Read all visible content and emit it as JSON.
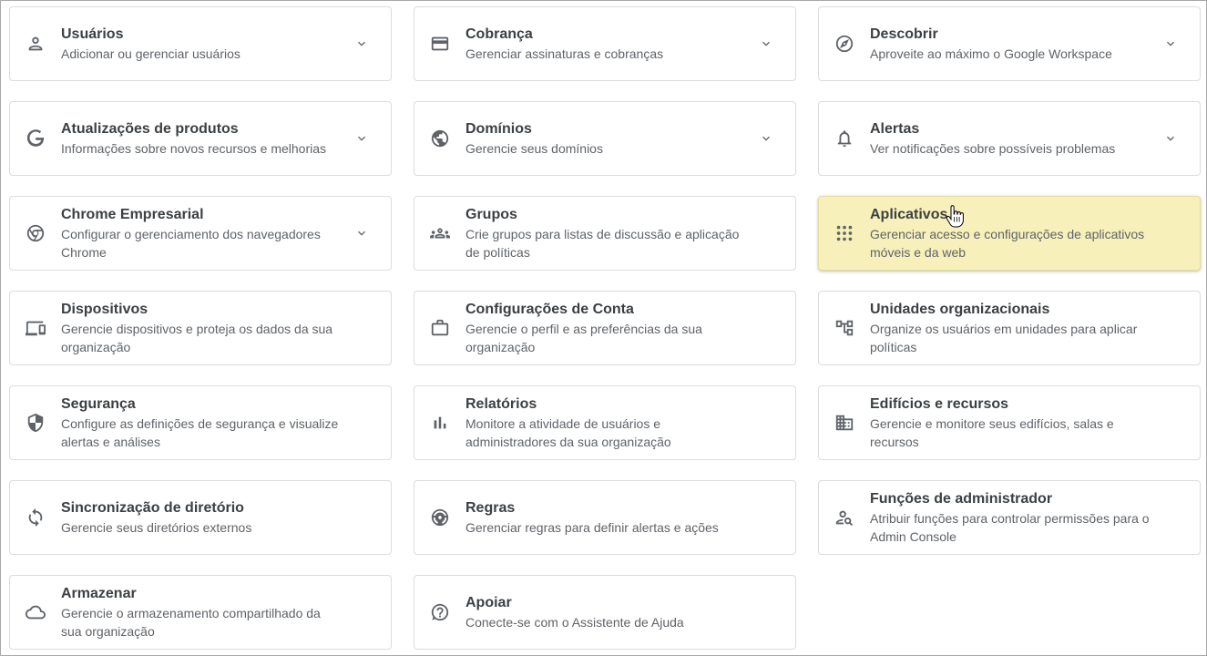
{
  "cards": [
    {
      "id": "usuarios",
      "title": "Usuários",
      "desc": "Adicionar ou gerenciar usuários",
      "icon": "person-icon",
      "chevron": true
    },
    {
      "id": "cobranca",
      "title": "Cobrança",
      "desc": "Gerenciar assinaturas e cobranças",
      "icon": "credit-card-icon",
      "chevron": true
    },
    {
      "id": "descobrir",
      "title": "Descobrir",
      "desc": "Aproveite ao máximo o Google Workspace",
      "icon": "compass-icon",
      "chevron": true
    },
    {
      "id": "atualizacoes",
      "title": "Atualizações de produtos",
      "desc": "Informações sobre novos recursos e melhorias",
      "icon": "google-g-icon",
      "chevron": true
    },
    {
      "id": "dominios",
      "title": "Domínios",
      "desc": "Gerencie seus domínios",
      "icon": "globe-icon",
      "chevron": true
    },
    {
      "id": "alertas",
      "title": "Alertas",
      "desc": "Ver notificações sobre possíveis problemas",
      "icon": "bell-icon",
      "chevron": true
    },
    {
      "id": "chrome",
      "title": "Chrome Empresarial",
      "desc": "Configurar o gerenciamento dos navegadores Chrome",
      "icon": "chrome-icon",
      "chevron": true
    },
    {
      "id": "grupos",
      "title": "Grupos",
      "desc": "Crie grupos para listas de discussão e aplicação de políticas",
      "icon": "groups-icon",
      "chevron": false
    },
    {
      "id": "aplicativos",
      "title": "Aplicativos",
      "desc": "Gerenciar acesso e configurações de aplicativos móveis e da web",
      "icon": "apps-grid-icon",
      "chevron": false,
      "highlight": true
    },
    {
      "id": "dispositivos",
      "title": "Dispositivos",
      "desc": "Gerencie dispositivos e proteja os dados da sua organização",
      "icon": "devices-icon",
      "chevron": false
    },
    {
      "id": "conta",
      "title": "Configurações de Conta",
      "desc": "Gerencie o perfil e as preferências da sua organização",
      "icon": "briefcase-icon",
      "chevron": false
    },
    {
      "id": "unidades",
      "title": "Unidades organizacionais",
      "desc": "Organize os usuários em unidades para aplicar políticas",
      "icon": "org-tree-icon",
      "chevron": false
    },
    {
      "id": "seguranca",
      "title": "Segurança",
      "desc": "Configure as definições de segurança e visualize alertas e análises",
      "icon": "shield-icon",
      "chevron": false
    },
    {
      "id": "relatorios",
      "title": "Relatórios",
      "desc": "Monitore a atividade de usuários e administradores da sua organização",
      "icon": "bar-chart-icon",
      "chevron": false
    },
    {
      "id": "edificios",
      "title": "Edifícios e recursos",
      "desc": "Gerencie e monitore seus edifícios, salas e recursos",
      "icon": "building-icon",
      "chevron": false
    },
    {
      "id": "sincronizacao",
      "title": "Sincronização de diretório",
      "desc": "Gerencie seus diretórios externos",
      "icon": "sync-icon",
      "chevron": false
    },
    {
      "id": "regras",
      "title": "Regras",
      "desc": "Gerenciar regras para definir alertas e ações",
      "icon": "rules-icon",
      "chevron": false
    },
    {
      "id": "funcoes",
      "title": "Funções de administrador",
      "desc": "Atribuir funções para controlar permissões para o Admin Console",
      "icon": "admin-roles-icon",
      "chevron": false
    },
    {
      "id": "armazenar",
      "title": "Armazenar",
      "desc": "Gerencie o armazenamento compartilhado da sua organização",
      "icon": "cloud-icon",
      "chevron": false
    },
    {
      "id": "apoiar",
      "title": "Apoiar",
      "desc": "Conecte-se com o Assistente de Ajuda",
      "icon": "help-icon",
      "chevron": false
    }
  ]
}
